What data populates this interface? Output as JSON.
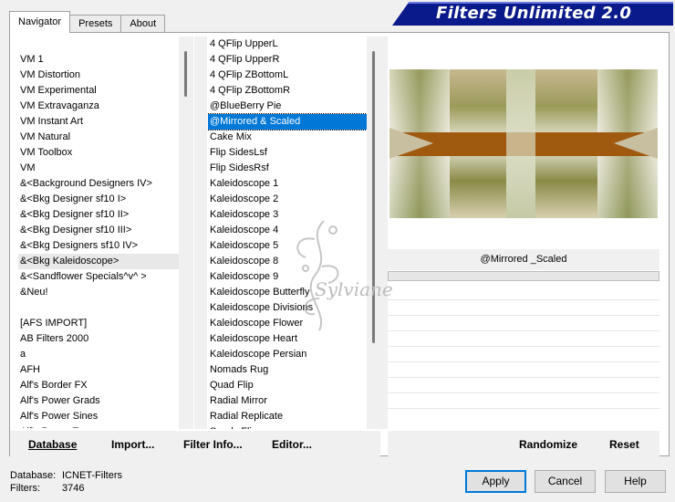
{
  "tabs": [
    {
      "label": "Navigator",
      "active": true
    },
    {
      "label": "Presets",
      "active": false
    },
    {
      "label": "About",
      "active": false
    }
  ],
  "banner": {
    "title": "Filters Unlimited 2.0",
    "color": "#0a1a8a"
  },
  "categories": [
    "VM 1",
    "VM Distortion",
    "VM Experimental",
    "VM Extravaganza",
    "VM Instant Art",
    "VM Natural",
    "VM Toolbox",
    "VM",
    "&<Background Designers IV>",
    "&<Bkg Designer sf10 I>",
    "&<Bkg Designer sf10 II>",
    "&<Bkg Designer sf10 III>",
    "&<Bkg Designers sf10 IV>",
    "&<Bkg Kaleidoscope>",
    "&<Sandflower Specials^v^ >",
    "&Neu!",
    "",
    "[AFS IMPORT]",
    "AB Filters 2000",
    "a",
    "AFH",
    "Alf's Border FX",
    "Alf's Power Grads",
    "Alf's Power Sines",
    "Alf's Power Toys"
  ],
  "categories_selected": "&<Bkg Kaleidoscope>",
  "filters": [
    "4 QFlip UpperL",
    "4 QFlip UpperR",
    "4 QFlip ZBottomL",
    "4 QFlip ZBottomR",
    "@BlueBerry Pie",
    "@Mirrored & Scaled",
    "Cake Mix",
    "Flip SidesLsf",
    "Flip SidesRsf",
    "Kaleidoscope 1",
    "Kaleidoscope 2",
    "Kaleidoscope 3",
    "Kaleidoscope 4",
    "Kaleidoscope 5",
    "Kaleidoscope 8",
    "Kaleidoscope 9",
    "Kaleidoscope Butterfly",
    "Kaleidoscope Divisions",
    "Kaleidoscope Flower",
    "Kaleidoscope Heart",
    "Kaleidoscope Persian",
    "Nomads Rug",
    "Quad Flip",
    "Radial Mirror",
    "Radial Replicate",
    "Sandy Flip"
  ],
  "filters_selected": "@Mirrored & Scaled",
  "preview": {
    "caption": "@Mirrored _Scaled"
  },
  "toolbar": {
    "database": "Database",
    "import": "Import...",
    "filter_info": "Filter Info...",
    "editor": "Editor...",
    "randomize": "Randomize",
    "reset": "Reset"
  },
  "footer": {
    "database_label": "Database:",
    "database_value": "ICNET-Filters",
    "filters_label": "Filters:",
    "filters_value": "3746",
    "apply": "Apply",
    "cancel": "Cancel",
    "help": "Help"
  },
  "watermark": {
    "text": "Sylviane"
  },
  "colors": {
    "selection": "#0078d7",
    "accent_brown": "#a05a10",
    "accent_olive": "#8a8a3a"
  }
}
